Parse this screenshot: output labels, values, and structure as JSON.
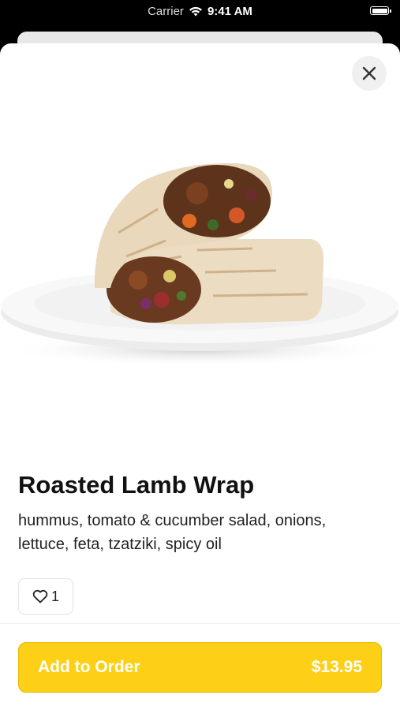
{
  "status_bar": {
    "carrier": "Carrier",
    "time": "9:41 AM"
  },
  "item": {
    "name": "Roasted Lamb Wrap",
    "description": "hummus, tomato & cucumber salad, onions, lettuce, feta, tzatziki, spicy oil",
    "likes": "1"
  },
  "order_button": {
    "label": "Add to Order",
    "price": "$13.95"
  },
  "colors": {
    "accent": "#fdd017"
  },
  "icons": [
    "wifi-icon",
    "battery-icon",
    "close-icon",
    "heart-icon"
  ]
}
